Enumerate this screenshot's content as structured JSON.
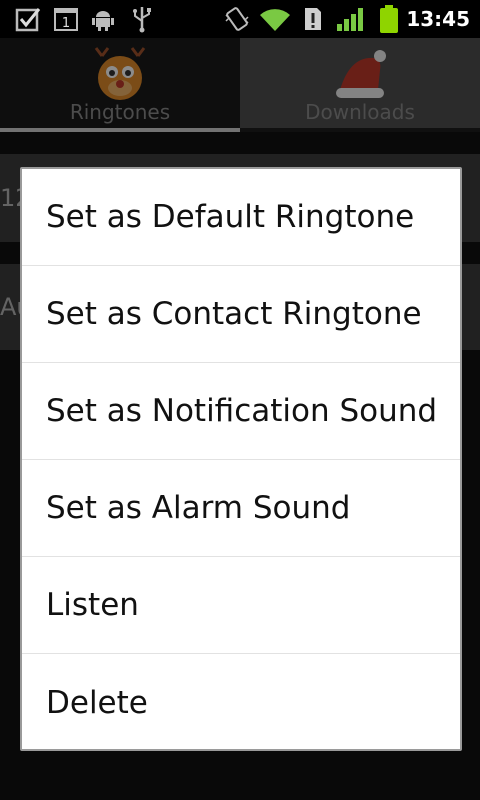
{
  "status_bar": {
    "time": "13:45",
    "icons": [
      "checkbox-icon",
      "calendar-icon",
      "android-debug-icon",
      "usb-icon",
      "vibrate-icon",
      "wifi-icon",
      "alert-icon",
      "signal-icon",
      "battery-icon"
    ],
    "calendar_day": "1"
  },
  "tabs": [
    {
      "label": "Ringtones",
      "selected": true,
      "icon": "reindeer-icon"
    },
    {
      "label": "Downloads",
      "selected": false,
      "icon": "santa-hat-icon"
    }
  ],
  "background_rows": [
    {
      "text": "12"
    },
    {
      "text": "Au"
    }
  ],
  "context_menu": {
    "items": [
      {
        "label": "Set as Default Ringtone"
      },
      {
        "label": "Set as Contact Ringtone"
      },
      {
        "label": "Set as Notification Sound"
      },
      {
        "label": "Set as Alarm Sound"
      },
      {
        "label": "Listen"
      },
      {
        "label": "Delete"
      }
    ]
  },
  "colors": {
    "wifi": "#7ac943",
    "signal": "#7ac943",
    "battery": "#8fd400",
    "dialog_bg": "#ffffff"
  }
}
